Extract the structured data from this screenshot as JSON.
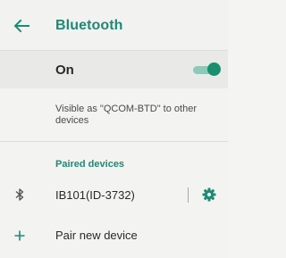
{
  "app_bar": {
    "back_icon": "arrow-back-icon",
    "title": "Bluetooth"
  },
  "master_switch": {
    "label": "On",
    "state": "on",
    "accent_color": "#1b8e6e"
  },
  "visibility": {
    "text": "Visible as \"QCOM-BTD\" to other devices"
  },
  "paired_devices": {
    "header": "Paired devices",
    "items": [
      {
        "icon": "bluetooth-icon",
        "name": "IB101(ID-3732)",
        "settings_icon": "gear-icon"
      }
    ]
  },
  "pair_new": {
    "icon": "plus-icon",
    "label": "Pair new device"
  },
  "colors": {
    "accent": "#1e8a76",
    "background": "#f3f3f1",
    "switch_bar": "#e9e9e7"
  }
}
